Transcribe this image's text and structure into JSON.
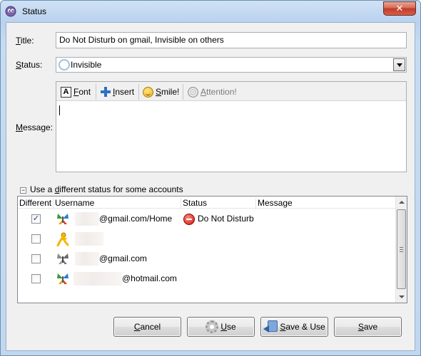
{
  "window": {
    "title": "Status",
    "close_label": "✕"
  },
  "form": {
    "title_label_ul": "T",
    "title_label_rest": "itle:",
    "title_value": "Do Not Disturb on gmail, Invisible on others",
    "status_label_ul": "S",
    "status_label_rest": "tatus:",
    "status_value": "Invisible",
    "message_label_ul": "M",
    "message_label_rest": "essage:"
  },
  "toolbar": {
    "font_ul": "F",
    "font_rest": "ont",
    "insert_ul": "I",
    "insert_rest": "nsert",
    "smile_ul": "S",
    "smile_rest": "mile!",
    "attention_ul": "A",
    "attention_rest": "ttention!",
    "font_icon_glyph": "A"
  },
  "accounts": {
    "section_label_a": "Use a ",
    "section_label_ul": "d",
    "section_label_b": "ifferent status for some accounts",
    "toggle_glyph": "−",
    "columns": {
      "different": "Different",
      "username": "Username",
      "status": "Status",
      "message": "Message"
    },
    "rows": [
      {
        "checked": "✓",
        "protocol_icon": "msn-butterfly-icon",
        "username": "@gmail.com/Home",
        "status": "Do Not Disturb"
      },
      {
        "checked": "",
        "protocol_icon": "aim-running-man-icon",
        "username": "",
        "status": ""
      },
      {
        "checked": "",
        "protocol_icon": "gray-butterfly-icon",
        "username": "@gmail.com",
        "status": ""
      },
      {
        "checked": "",
        "protocol_icon": "msn-butterfly-icon",
        "username": "@hotmail.com",
        "status": ""
      }
    ]
  },
  "buttons": {
    "cancel_ul": "C",
    "cancel_rest": "ancel",
    "use_ul": "U",
    "use_rest": "se",
    "save_use_ul": "S",
    "save_use_rest": "ave & Use",
    "save_ul": "S",
    "save_rest": "ave"
  },
  "colors": {
    "titlebar": "#b9d2ee",
    "close_button": "#c0392b",
    "dialog_bg": "#f0f0f0",
    "dnd_status": "#d2140f"
  }
}
